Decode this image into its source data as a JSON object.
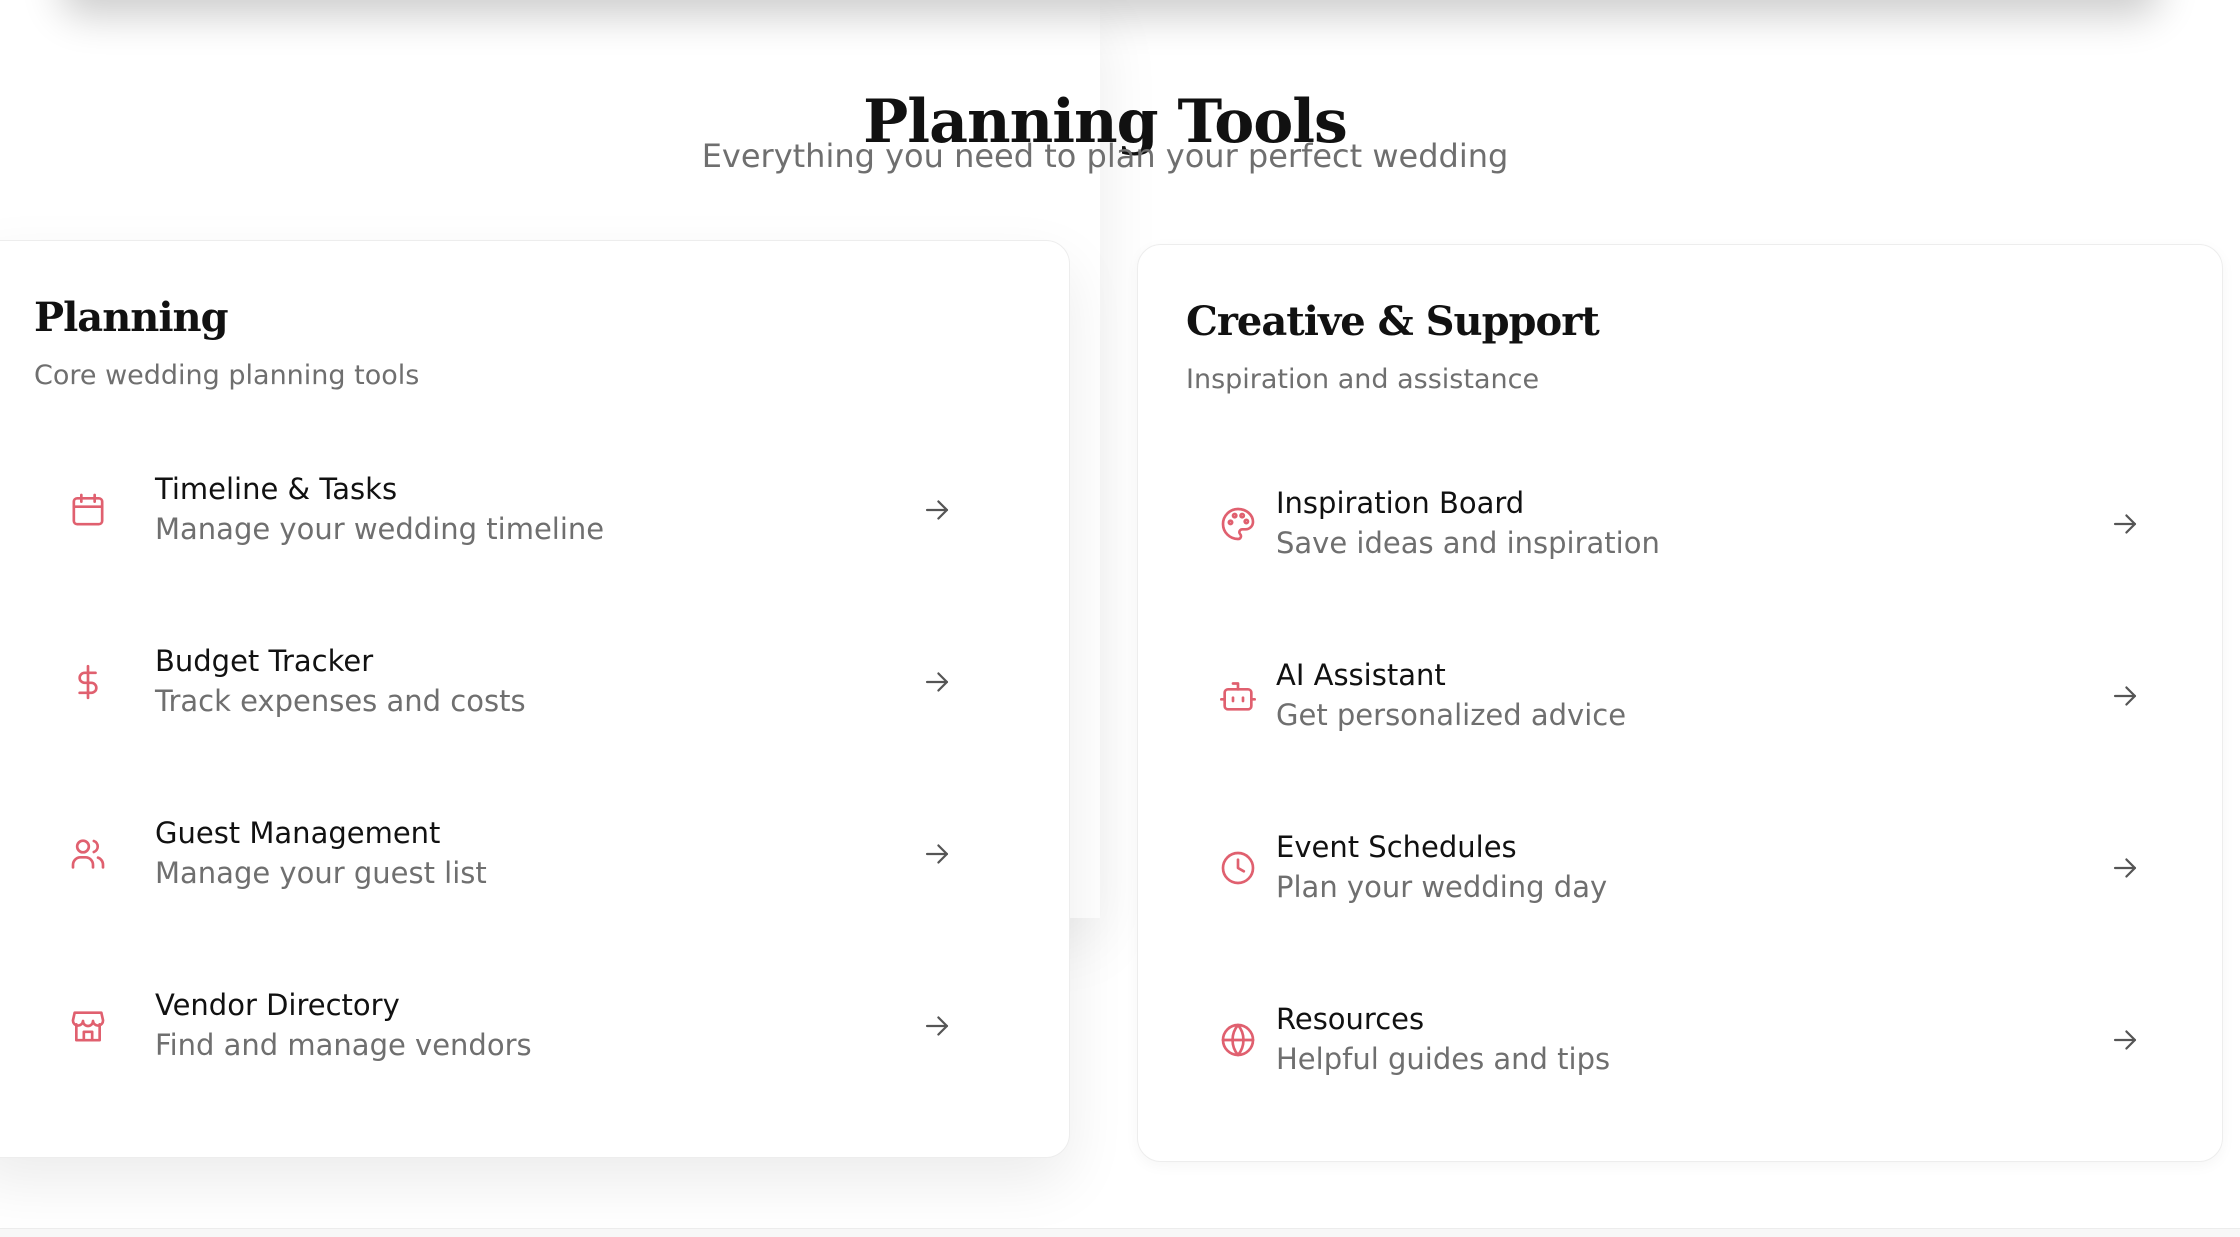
{
  "header": {
    "title": "Planning Tools",
    "subtitle": "Everything you need to plan your perfect wedding"
  },
  "accent_color": "#e0606f",
  "sections": [
    {
      "title": "Planning",
      "description": "Core wedding planning tools",
      "items": [
        {
          "icon": "calendar-icon",
          "title": "Timeline & Tasks",
          "subtitle": "Manage your wedding timeline"
        },
        {
          "icon": "dollar-icon",
          "title": "Budget Tracker",
          "subtitle": "Track expenses and costs"
        },
        {
          "icon": "users-icon",
          "title": "Guest Management",
          "subtitle": "Manage your guest list"
        },
        {
          "icon": "store-icon",
          "title": "Vendor Directory",
          "subtitle": "Find and manage vendors"
        }
      ]
    },
    {
      "title": "Creative & Support",
      "description": "Inspiration and assistance",
      "items": [
        {
          "icon": "palette-icon",
          "title": "Inspiration Board",
          "subtitle": "Save ideas and inspiration"
        },
        {
          "icon": "bot-icon",
          "title": "AI Assistant",
          "subtitle": "Get personalized advice"
        },
        {
          "icon": "clock-icon",
          "title": "Event Schedules",
          "subtitle": "Plan your wedding day"
        },
        {
          "icon": "globe-icon",
          "title": "Resources",
          "subtitle": "Helpful guides and tips"
        }
      ]
    }
  ]
}
